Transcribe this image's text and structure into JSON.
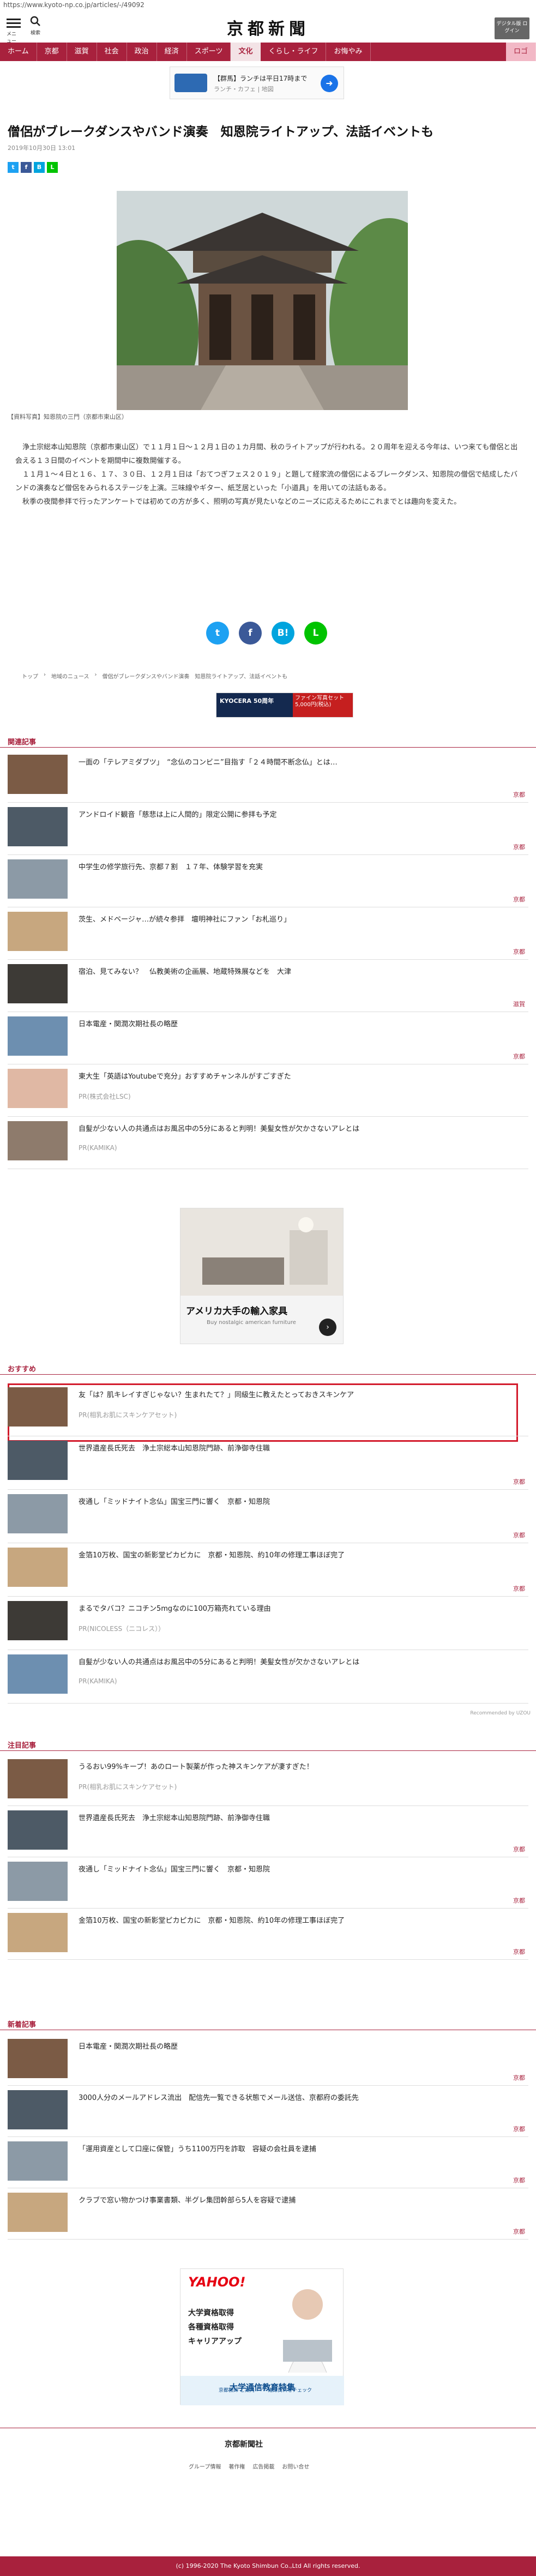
{
  "url": "https://www.kyoto-np.co.jp/articles/-/49092",
  "header": {
    "menu_label": "メニュー",
    "search_label": "検索",
    "logo": "京都新聞",
    "digital_label": "デジタル版 ログイン"
  },
  "nav": [
    "ホーム",
    "京都",
    "滋賀",
    "社会",
    "政治",
    "経済",
    "スポーツ",
    "文化",
    "くらし・ライフ",
    "お悔やみ",
    "ロゴ"
  ],
  "ad_top": {
    "title": "【群馬】ランチは平日17時まで",
    "sub": "ランチ・カフェ | 地図"
  },
  "article": {
    "title": "僧侶がブレークダンスやバンド演奏　知恩院ライトアップ、法話イベントも",
    "date": "2019年10月30日 13:01",
    "caption": "【資料写真】知恩院の三門（京都市東山区）",
    "paragraphs": [
      "浄土宗総本山知恩院（京都市東山区）で１１月１日〜１２月１日の１カ月間、秋のライトアップが行われる。２０周年を迎える今年は、いつ来ても僧侶と出会える１３日間のイベントを期間中に複数開催する。",
      "１１月１〜４日と１６、１７、３０日、１２月１日は「おてつぎフェス２０１９」と題して経家流の僧侶によるブレークダンス、知恩院の僧侶で結成したバンドの演奏など僧侶をみられるステージを上演。三味線やギター、紙芝居といった「小道具」を用いての法話もある。",
      "秋季の夜間参拝で行ったアンケートでは初めての方が多く、照明の写真が見たいなどのニーズに応えるためにこれまでとは趣向を変えた。"
    ]
  },
  "breadcrumb": [
    "トップ",
    "地域のニュース",
    "僧侶がブレークダンスやバンド演奏　知恩院ライトアップ、法話イベントも"
  ],
  "ad2": {
    "left": "KYOCERA 50周年",
    "right": "ファイン写真セット 5,000円(税込)"
  },
  "sections": {
    "related": "関連記事",
    "recommended": "おすすめ",
    "noteworthy": "注目記事",
    "latest": "新着記事"
  },
  "related": [
    {
      "title": "一面の「テレアミダブツ」　“念仏のコンビニ”目指す「２４時間不断念仏」とは…",
      "tag": "京都"
    },
    {
      "title": "アンドロイド観音「慈悲は上に人間的」限定公開に参拝も予定",
      "tag": "京都"
    },
    {
      "title": "中学生の修学旅行先、京都７割　１７年、体験学習を充実",
      "tag": "京都"
    },
    {
      "title": "茨生、メドベージャ…が続々参拝　壇明神社にファン「お札巡り」",
      "tag": "京都"
    },
    {
      "title": "宿泊、見てみない？　仏教美術の企画展、地蔵特殊展などを　大津",
      "tag": "滋賀"
    },
    {
      "title": "日本電産・関潤次期社長の略歴",
      "tag": "京都"
    },
    {
      "title": "東大生「英語はYoutubeで充分」おすすめチャンネルがすごすぎた",
      "pr": "PR(株式会社LSC)"
    },
    {
      "title": "自髪が少ない人の共通点はお風呂中の5分にあると判明！美髪女性が欠かさないアレとは",
      "pr": "PR(KAMIKA)"
    }
  ],
  "ad3": {
    "title": "アメリカ大手の輸入家具",
    "sub": "Buy nostalgic american furniture"
  },
  "recommended": [
    {
      "title": "友「は？肌キレイすぎじゃない？生まれたて？」同級生に教えたとっておきスキンケア",
      "pr": "PR(相乳お肌にスキンケアセット)"
    },
    {
      "title": "世界遺産長氏死去　浄土宗総本山知恩院門跡、前浄御寺住職",
      "tag": "京都"
    },
    {
      "title": "夜通し「ミッドナイト念仏」国宝三門に響く　京都・知恩院",
      "tag": "京都"
    },
    {
      "title": "金箔10万枚、国宝の新影堂ピカピカに　京都・知恩院、約10年の修理工事ほぼ完了",
      "tag": "京都"
    },
    {
      "title": "まるでタバコ？ニコチン5mgなのに100万箱売れている理由",
      "pr": "PR(NICOLESS（ニコレス））"
    },
    {
      "title": "自髪が少ない人の共通点はお風呂中の5分にあると判明！美髪女性が欠かさないアレとは",
      "pr": "PR(KAMIKA)"
    }
  ],
  "recommended_by": "Recommended by UZOU",
  "noteworthy": [
    {
      "title": "うるおい99%キープ！あのロート製薬が作った神スキンケアが凄すぎた！",
      "pr": "PR(相乳お肌にスキンケアセット)"
    },
    {
      "title": "世界遺産長氏死去　浄土宗総本山知恩院門跡、前浄御寺住職",
      "tag": "京都"
    },
    {
      "title": "夜通し「ミッドナイト念仏」国宝三門に響く　京都・知恩院",
      "tag": "京都"
    },
    {
      "title": "金箔10万枚、国宝の新影堂ピカピカに　京都・知恩院、約10年の修理工事ほぼ完了",
      "tag": "京都"
    }
  ],
  "latest": [
    {
      "title": "日本電産・関潤次期社長の略歴",
      "tag": "京都"
    },
    {
      "title": "3000人分のメールアドレス流出　配信先一覧できる状態でメール送信、京都府の委託先",
      "tag": "京都"
    },
    {
      "title": "「運用資産として口座に保管」うち1100万円を詐取　容疑の会社員を逮捕",
      "tag": "京都"
    },
    {
      "title": "クラブで窓い物かつけ事業書類、半グレ集団幹部ら5人を容疑で逮捕",
      "tag": "京都"
    }
  ],
  "ad4": {
    "brand": "YAHOO!",
    "lines": [
      "大学資格取得",
      "各種資格取得",
      "キャリアアップ"
    ],
    "bar": "大学通信教育特集",
    "btn1": "京都教師 ご案内",
    "btn2": "雑誌資料をチェック"
  },
  "footer": {
    "logo": "京都新聞社",
    "links": [
      "グループ情報",
      "著作権",
      "広告掲載",
      "お問い合せ"
    ],
    "copyright": "(c) 1996-2020 The Kyoto Shimbun Co.,Ltd All rights reserved."
  }
}
